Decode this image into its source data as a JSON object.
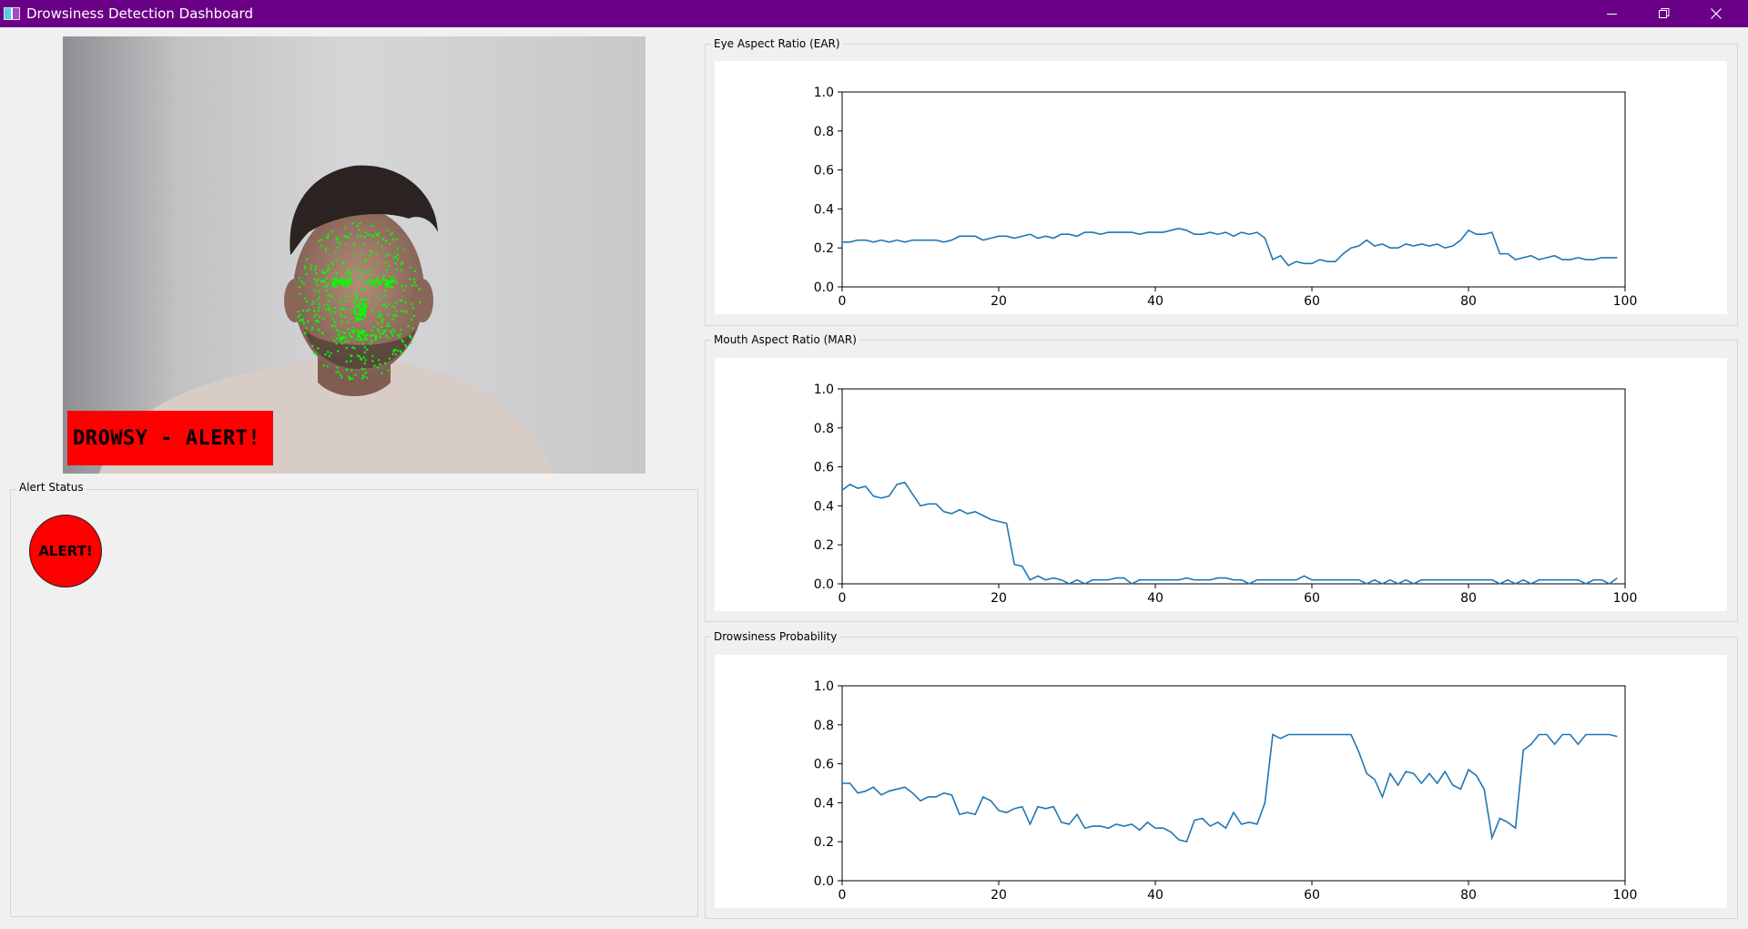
{
  "window": {
    "title": "Drowsiness Detection Dashboard",
    "controls": [
      "minimize-icon",
      "restore-icon",
      "close-icon"
    ],
    "titlebar_color": "#6a0085"
  },
  "video": {
    "overlay_text": "DROWSY - ALERT!",
    "overlay_color": "#ff0000",
    "landmark_color": "#00ff00"
  },
  "alert_status": {
    "group_title": "Alert Status",
    "indicator_label": "ALERT!",
    "indicator_color": "#ff0000"
  },
  "charts": [
    {
      "group_title": "Eye Aspect Ratio (EAR)"
    },
    {
      "group_title": "Mouth Aspect Ratio (MAR)"
    },
    {
      "group_title": "Drowsiness Probability"
    }
  ],
  "chart_data": [
    {
      "type": "line",
      "title": "Eye Aspect Ratio (EAR)",
      "xlim": [
        0,
        100
      ],
      "ylim": [
        0,
        1
      ],
      "xticks": [
        0,
        20,
        40,
        60,
        80,
        100
      ],
      "yticks": [
        0.0,
        0.2,
        0.4,
        0.6,
        0.8,
        1.0
      ],
      "xtick_labels": [
        "0",
        "20",
        "40",
        "60",
        "80",
        "100"
      ],
      "ytick_labels": [
        "0.0",
        "0.2",
        "0.4",
        "0.6",
        "0.8",
        "1.0"
      ],
      "grid": false,
      "line_color": "#1f77b4",
      "series": [
        {
          "values": [
            0.23,
            0.23,
            0.24,
            0.24,
            0.23,
            0.24,
            0.23,
            0.24,
            0.23,
            0.24,
            0.24,
            0.24,
            0.24,
            0.23,
            0.24,
            0.26,
            0.26,
            0.26,
            0.24,
            0.25,
            0.26,
            0.26,
            0.25,
            0.26,
            0.27,
            0.25,
            0.26,
            0.25,
            0.27,
            0.27,
            0.26,
            0.28,
            0.28,
            0.27,
            0.28,
            0.28,
            0.28,
            0.28,
            0.27,
            0.28,
            0.28,
            0.28,
            0.29,
            0.3,
            0.29,
            0.27,
            0.27,
            0.28,
            0.27,
            0.28,
            0.26,
            0.28,
            0.27,
            0.28,
            0.25,
            0.14,
            0.16,
            0.11,
            0.13,
            0.12,
            0.12,
            0.14,
            0.13,
            0.13,
            0.17,
            0.2,
            0.21,
            0.24,
            0.21,
            0.22,
            0.2,
            0.2,
            0.22,
            0.21,
            0.22,
            0.21,
            0.22,
            0.2,
            0.21,
            0.24,
            0.29,
            0.27,
            0.27,
            0.28,
            0.17,
            0.17,
            0.14,
            0.15,
            0.16,
            0.14,
            0.15,
            0.16,
            0.14,
            0.14,
            0.15,
            0.14,
            0.14,
            0.15,
            0.15,
            0.15
          ]
        }
      ]
    },
    {
      "type": "line",
      "title": "Mouth Aspect Ratio (MAR)",
      "xlim": [
        0,
        100
      ],
      "ylim": [
        0,
        1
      ],
      "xticks": [
        0,
        20,
        40,
        60,
        80,
        100
      ],
      "yticks": [
        0.0,
        0.2,
        0.4,
        0.6,
        0.8,
        1.0
      ],
      "xtick_labels": [
        "0",
        "20",
        "40",
        "60",
        "80",
        "100"
      ],
      "ytick_labels": [
        "0.0",
        "0.2",
        "0.4",
        "0.6",
        "0.8",
        "1.0"
      ],
      "grid": false,
      "line_color": "#1f77b4",
      "series": [
        {
          "values": [
            0.48,
            0.51,
            0.49,
            0.5,
            0.45,
            0.44,
            0.45,
            0.51,
            0.52,
            0.46,
            0.4,
            0.41,
            0.41,
            0.37,
            0.36,
            0.38,
            0.36,
            0.37,
            0.35,
            0.33,
            0.32,
            0.31,
            0.1,
            0.09,
            0.02,
            0.04,
            0.02,
            0.03,
            0.02,
            0.0,
            0.02,
            0.0,
            0.02,
            0.02,
            0.02,
            0.03,
            0.03,
            0.0,
            0.02,
            0.02,
            0.02,
            0.02,
            0.02,
            0.02,
            0.03,
            0.02,
            0.02,
            0.02,
            0.03,
            0.03,
            0.02,
            0.02,
            0.0,
            0.02,
            0.02,
            0.02,
            0.02,
            0.02,
            0.02,
            0.04,
            0.02,
            0.02,
            0.02,
            0.02,
            0.02,
            0.02,
            0.02,
            0.0,
            0.02,
            0.0,
            0.02,
            0.0,
            0.02,
            0.0,
            0.02,
            0.02,
            0.02,
            0.02,
            0.02,
            0.02,
            0.02,
            0.02,
            0.02,
            0.02,
            0.0,
            0.02,
            0.0,
            0.02,
            0.0,
            0.02,
            0.02,
            0.02,
            0.02,
            0.02,
            0.02,
            0.0,
            0.02,
            0.02,
            0.0,
            0.03
          ]
        }
      ]
    },
    {
      "type": "line",
      "title": "Drowsiness Probability",
      "xlim": [
        0,
        100
      ],
      "ylim": [
        0,
        1
      ],
      "xticks": [
        0,
        20,
        40,
        60,
        80,
        100
      ],
      "yticks": [
        0.0,
        0.2,
        0.4,
        0.6,
        0.8,
        1.0
      ],
      "xtick_labels": [
        "0",
        "20",
        "40",
        "60",
        "80",
        "100"
      ],
      "ytick_labels": [
        "0.0",
        "0.2",
        "0.4",
        "0.6",
        "0.8",
        "1.0"
      ],
      "grid": false,
      "line_color": "#1f77b4",
      "series": [
        {
          "values": [
            0.5,
            0.5,
            0.45,
            0.46,
            0.48,
            0.44,
            0.46,
            0.47,
            0.48,
            0.45,
            0.41,
            0.43,
            0.43,
            0.45,
            0.44,
            0.34,
            0.35,
            0.34,
            0.43,
            0.41,
            0.36,
            0.35,
            0.37,
            0.38,
            0.29,
            0.38,
            0.37,
            0.38,
            0.3,
            0.29,
            0.34,
            0.27,
            0.28,
            0.28,
            0.27,
            0.29,
            0.28,
            0.29,
            0.26,
            0.3,
            0.27,
            0.27,
            0.25,
            0.21,
            0.2,
            0.31,
            0.32,
            0.28,
            0.3,
            0.27,
            0.35,
            0.29,
            0.3,
            0.29,
            0.4,
            0.75,
            0.73,
            0.75,
            0.75,
            0.75,
            0.75,
            0.75,
            0.75,
            0.75,
            0.75,
            0.75,
            0.66,
            0.55,
            0.52,
            0.43,
            0.55,
            0.49,
            0.56,
            0.55,
            0.5,
            0.55,
            0.5,
            0.56,
            0.49,
            0.47,
            0.57,
            0.54,
            0.47,
            0.22,
            0.32,
            0.3,
            0.27,
            0.67,
            0.7,
            0.75,
            0.75,
            0.7,
            0.75,
            0.75,
            0.7,
            0.75,
            0.75,
            0.75,
            0.75,
            0.74
          ]
        }
      ]
    }
  ]
}
